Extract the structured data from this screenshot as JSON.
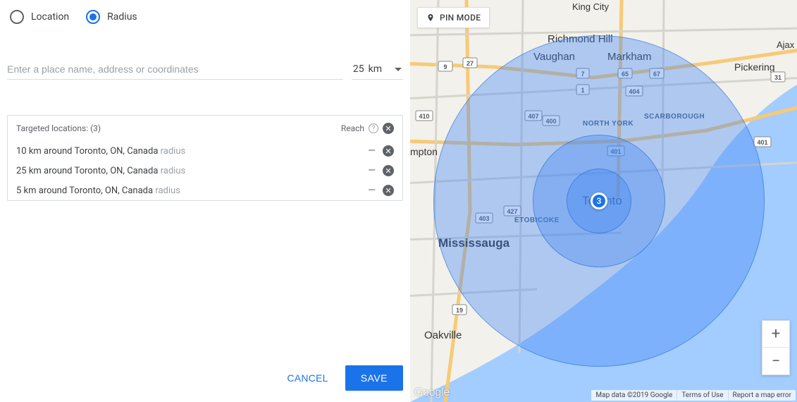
{
  "radios": {
    "location": "Location",
    "radius": "Radius",
    "selected": "radius"
  },
  "search": {
    "placeholder": "Enter a place name, address or coordinates",
    "radius_value": "25",
    "radius_unit": "km"
  },
  "locations": {
    "header_label": "Targeted locations: (3)",
    "reach_label": "Reach",
    "items": [
      {
        "text": "10 km around Toronto, ON, Canada",
        "suffix": "radius",
        "reach": "—"
      },
      {
        "text": "25 km around Toronto, ON, Canada",
        "suffix": "radius",
        "reach": "—"
      },
      {
        "text": "5 km around Toronto, ON, Canada",
        "suffix": "radius",
        "reach": "—"
      }
    ]
  },
  "buttons": {
    "cancel": "CANCEL",
    "save": "SAVE"
  },
  "map": {
    "pin_mode": "PIN MODE",
    "center_marker_label": "3",
    "attrib_data": "Map data ©2019 Google",
    "attrib_terms": "Terms of Use",
    "attrib_report": "Report a map error",
    "logo": "Google",
    "labels": {
      "king_city": "King City",
      "richmond_hill": "Richmond Hill",
      "vaughan": "Vaughan",
      "markham": "Markham",
      "pickering": "Pickering",
      "ajax": "Ajax",
      "north_york": "NORTH YORK",
      "scarborough": "SCARBOROUGH",
      "toronto": "Toronto",
      "etobicoke": "ETOBICOKE",
      "mississauga": "Mississauga",
      "oakville": "Oakville",
      "mpton": "mpton"
    },
    "shields": [
      "9",
      "27",
      "404",
      "65",
      "67",
      "31",
      "407",
      "400",
      "401",
      "427",
      "403",
      "19",
      "401",
      "410",
      "1",
      "7"
    ]
  }
}
